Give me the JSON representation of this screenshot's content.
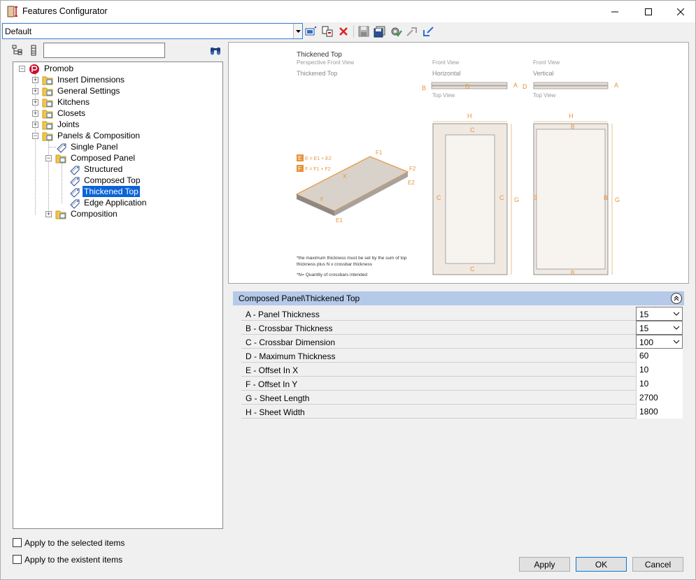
{
  "window": {
    "title": "Features Configurator"
  },
  "toolbar": {
    "profile_value": "Default"
  },
  "tree": {
    "root": "Promob",
    "items": [
      "Insert Dimensions",
      "General Settings",
      "Kitchens",
      "Closets",
      "Joints",
      "Panels & Composition",
      "Single Panel",
      "Composed Panel",
      "Structured",
      "Composed Top",
      "Thickened Top",
      "Edge Application",
      "Composition"
    ]
  },
  "options": {
    "apply_selected": "Apply to the selected items",
    "apply_existent": "Apply to the existent items"
  },
  "preview": {
    "title": "Thickened Top",
    "subtitle": "Perspective Front View",
    "name": "Thickened Top",
    "front_view_1": "Front View",
    "orientation_1": "Horizontal",
    "top_view_1": "Top View",
    "front_view_2": "Front View",
    "orientation_2": "Vertical",
    "top_view_2": "Top View",
    "formula_e": "E = E1 + E2",
    "formula_f": "F = F1 + F2",
    "note_line1": "*the maximum thickness must be set by the sum of top",
    "note_line2": "thickness plus N x crossbar thickness",
    "note_line3": "*N= Quantity of crossbars intended",
    "labels": {
      "a": "A",
      "b": "B",
      "c": "C",
      "d": "D",
      "e": "E",
      "f": "F",
      "g": "G",
      "h": "H",
      "x": "X",
      "y": "Y",
      "e1": "E1",
      "e2": "E2",
      "f1": "F1",
      "f2": "F2"
    },
    "accent_color": "#e8923a"
  },
  "properties": {
    "header": "Composed Panel\\Thickened Top",
    "rows": [
      {
        "label": "A -  Panel Thickness",
        "value": "15"
      },
      {
        "label": "B -  Crossbar Thickness",
        "value": "15"
      },
      {
        "label": "C -  Crossbar Dimension",
        "value": "100"
      },
      {
        "label": "D -  Maximum Thickness",
        "value": "60"
      },
      {
        "label": "E -  Offset In X",
        "value": "10"
      },
      {
        "label": "F -  Offset In Y",
        "value": "10"
      },
      {
        "label": "G -  Sheet Length",
        "value": "2700"
      },
      {
        "label": "H -  Sheet Width",
        "value": "1800"
      }
    ]
  },
  "buttons": {
    "apply": "Apply",
    "ok": "OK",
    "cancel": "Cancel"
  }
}
